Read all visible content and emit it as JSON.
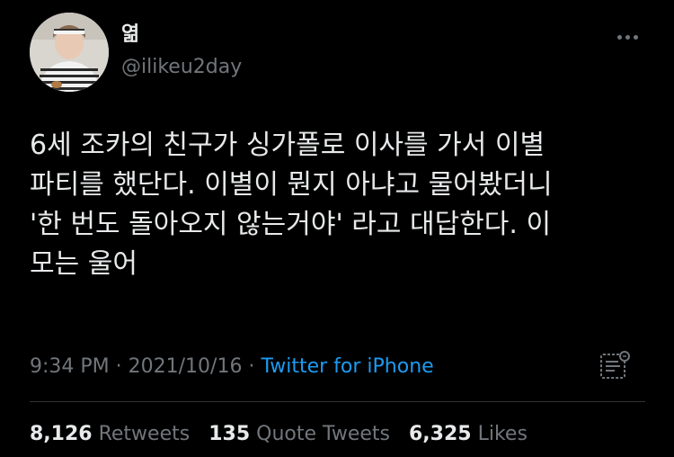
{
  "user": {
    "display_name": "엶",
    "handle": "@ilikeu2day"
  },
  "tweet": {
    "text": "6세 조카의 친구가 싱가폴로 이사를 가서 이별\n파티를 했단다. 이별이 뭔지 아냐고 물어봤더니\n'한 번도 돌아오지 않는거야' 라고 대답한다. 이\n모는 울어"
  },
  "meta": {
    "time": "9:34 PM",
    "separator1": " · ",
    "date": "2021/10/16",
    "separator2": " · ",
    "source": "Twitter for iPhone"
  },
  "stats": {
    "retweets_count": "8,126",
    "retweets_label": "Retweets",
    "quote_count": "135",
    "quote_label": "Quote Tweets",
    "likes_count": "6,325",
    "likes_label": "Likes"
  },
  "icons": {
    "more": "more-horizontal-icon",
    "analytics": "analytics-icon"
  },
  "colors": {
    "background": "#000000",
    "text": "#e7e9ea",
    "secondary": "#71767b",
    "link": "#1d9bf0",
    "divider": "#2f3336"
  }
}
